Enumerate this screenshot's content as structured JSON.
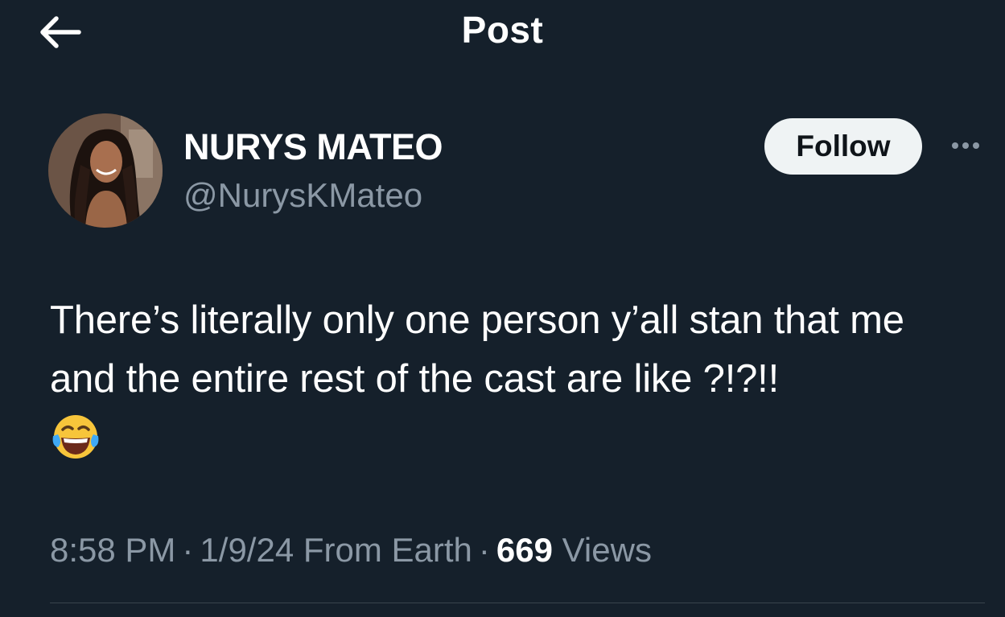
{
  "header": {
    "title": "Post",
    "back_icon": "back-arrow-icon"
  },
  "author": {
    "display_name": "NURYS MATEO",
    "handle": "@NurysKMateo",
    "avatar": "profile-photo",
    "follow_label": "Follow",
    "more_icon": "more-options-icon"
  },
  "tweet": {
    "text": "There’s literally only one person y’all stan that me and the entire rest of the cast are like ?!?!!",
    "emoji": "face-with-tears-of-joy"
  },
  "meta": {
    "time": "8:58 PM",
    "separator": "·",
    "date": "1/9/24",
    "location": "From Earth",
    "views_count": "669",
    "views_label": "Views"
  },
  "colors": {
    "background": "#15202b",
    "text": "#ffffff",
    "secondary_text": "#8b98a5",
    "follow_button_bg": "#eff3f4",
    "divider": "#38444d"
  }
}
